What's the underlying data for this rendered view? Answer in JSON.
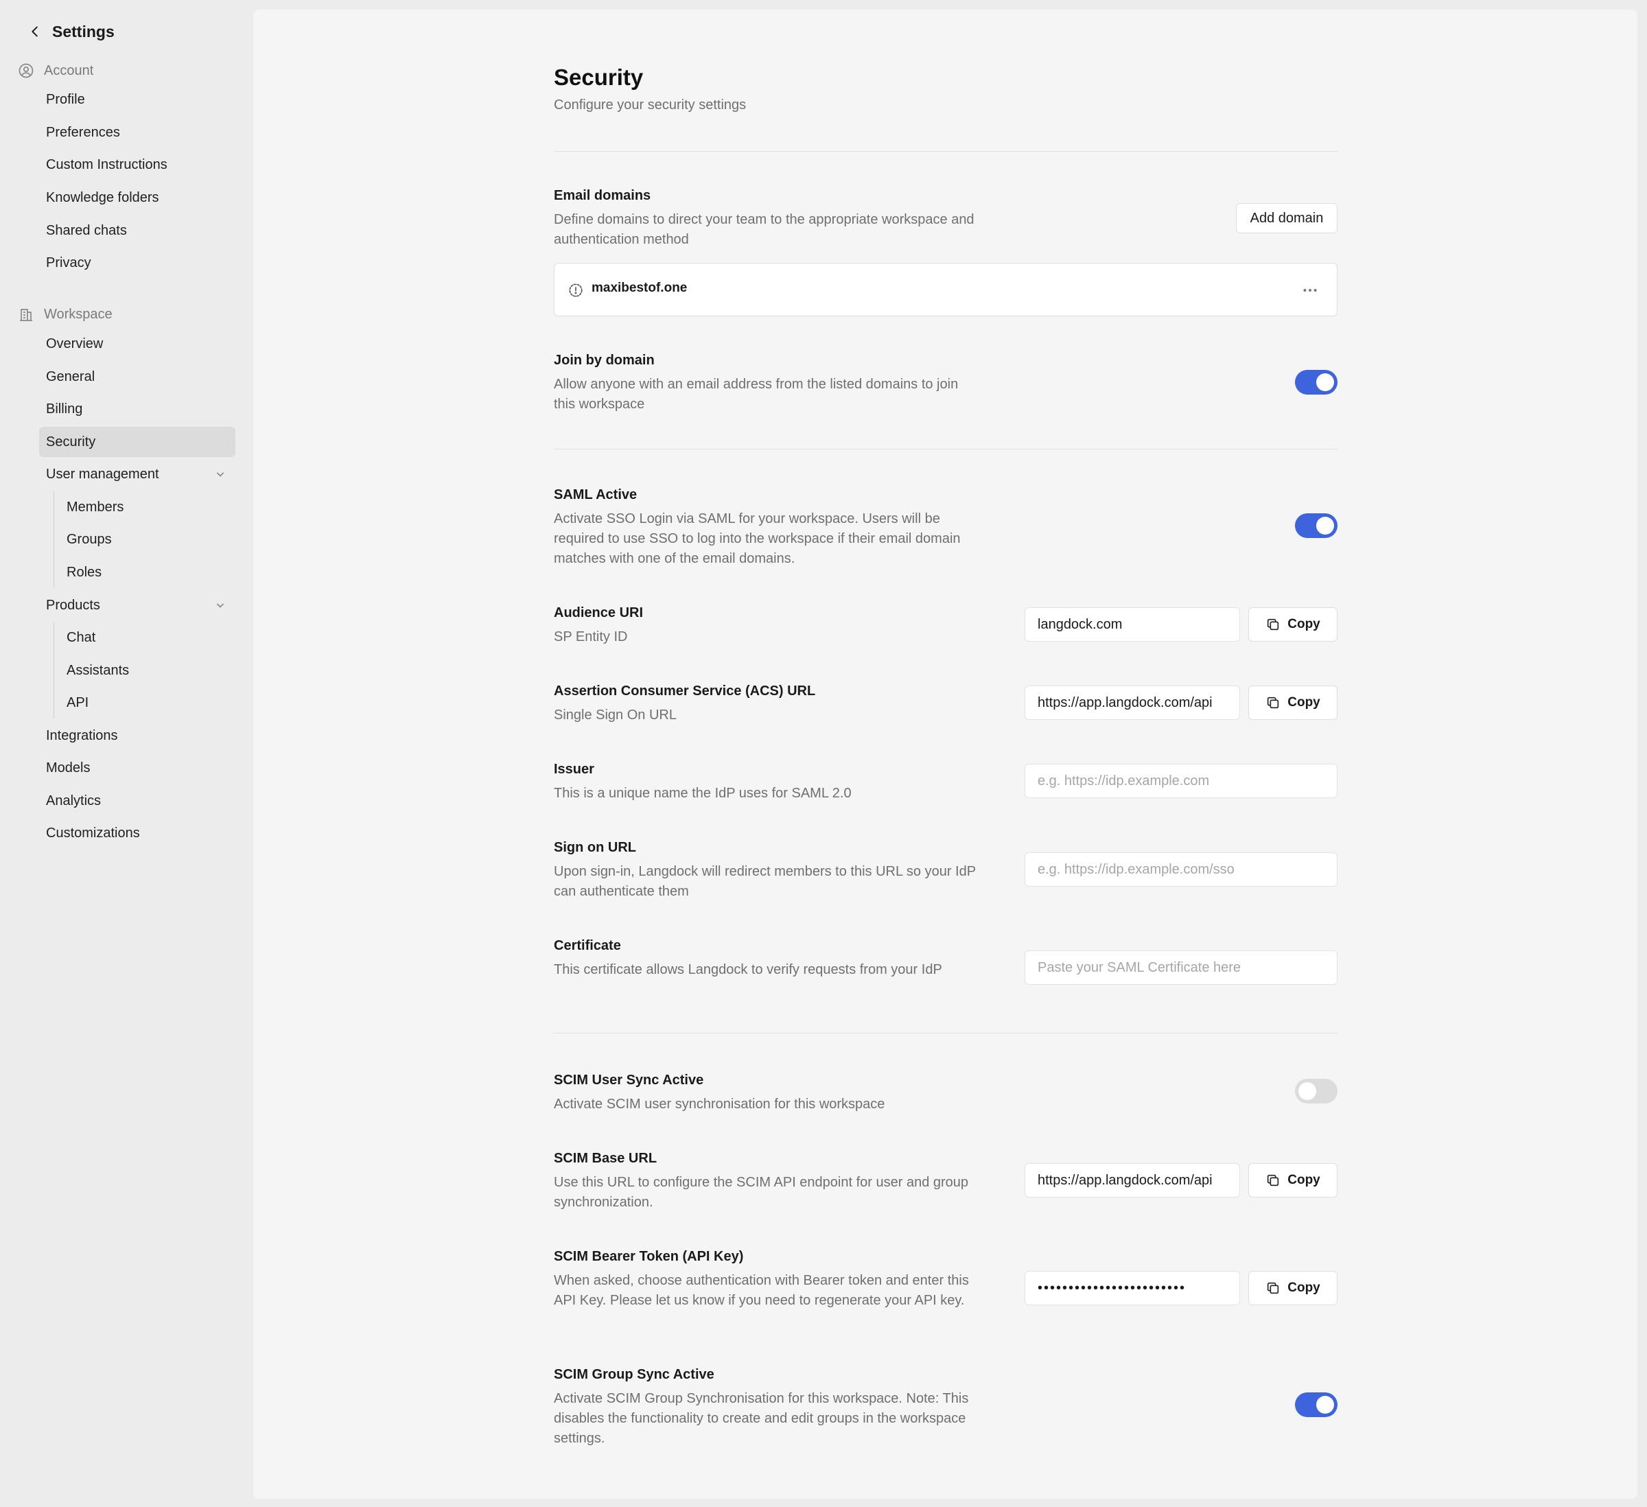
{
  "sidebar": {
    "title": "Settings",
    "account": {
      "label": "Account",
      "items": [
        "Profile",
        "Preferences",
        "Custom Instructions",
        "Knowledge folders",
        "Shared chats",
        "Privacy"
      ]
    },
    "workspace": {
      "label": "Workspace",
      "items": {
        "overview": "Overview",
        "general": "General",
        "billing": "Billing",
        "security": "Security",
        "user_management": "User management",
        "user_sub": [
          "Members",
          "Groups",
          "Roles"
        ],
        "products": "Products",
        "product_sub": [
          "Chat",
          "Assistants",
          "API"
        ],
        "integrations": "Integrations",
        "models": "Models",
        "analytics": "Analytics",
        "customizations": "Customizations"
      }
    }
  },
  "page": {
    "title": "Security",
    "subtitle": "Configure your security settings"
  },
  "email_domains": {
    "label": "Email domains",
    "desc": "Define domains to direct your team to the appropriate workspace and authentication method",
    "button": "Add domain",
    "domain": "maxibestof.one"
  },
  "join_by_domain": {
    "label": "Join by domain",
    "desc": "Allow anyone with an email address from the listed domains to join this workspace",
    "enabled": true
  },
  "saml": {
    "label": "SAML Active",
    "desc": "Activate SSO Login via SAML for your workspace. Users will be required to use SSO to log into the workspace if their email domain matches with one of the email domains.",
    "enabled": true,
    "audience": {
      "label": "Audience URI",
      "desc": "SP Entity ID",
      "value": "langdock.com",
      "copy": "Copy"
    },
    "acs": {
      "label": "Assertion Consumer Service (ACS) URL",
      "desc": "Single Sign On URL",
      "value": "https://app.langdock.com/api",
      "copy": "Copy"
    },
    "issuer": {
      "label": "Issuer",
      "desc": "This is a unique name the IdP uses for SAML 2.0",
      "placeholder": "e.g. https://idp.example.com"
    },
    "sign_on": {
      "label": "Sign on URL",
      "desc": "Upon sign-in, Langdock will redirect members to this URL so your IdP can authenticate them",
      "placeholder": "e.g. https://idp.example.com/sso"
    },
    "certificate": {
      "label": "Certificate",
      "desc": "This certificate allows Langdock to verify requests from your IdP",
      "placeholder": "Paste your SAML Certificate here"
    }
  },
  "scim": {
    "user_sync": {
      "label": "SCIM User Sync Active",
      "desc": "Activate SCIM user synchronisation for this workspace",
      "enabled": false
    },
    "base_url": {
      "label": "SCIM Base URL",
      "desc": "Use this URL to configure the SCIM API endpoint for user and group synchronization.",
      "value": "https://app.langdock.com/api",
      "copy": "Copy"
    },
    "token": {
      "label": "SCIM Bearer Token (API Key)",
      "desc": "When asked, choose authentication with Bearer token and enter this API Key. Please let us know if you need to regenerate your API key.",
      "value": "••••••••••••••••••••••••",
      "copy": "Copy"
    },
    "group_sync": {
      "label": "SCIM Group Sync Active",
      "desc": "Activate SCIM Group Synchronisation for this workspace. Note: This disables the functionality to create and edit groups in the workspace settings.",
      "enabled": true
    }
  },
  "colors": {
    "accent": "#3d63dd",
    "toggle_off": "#dcdcdc",
    "sidebar_bg": "#ececec",
    "panel_bg": "#f5f5f5"
  }
}
